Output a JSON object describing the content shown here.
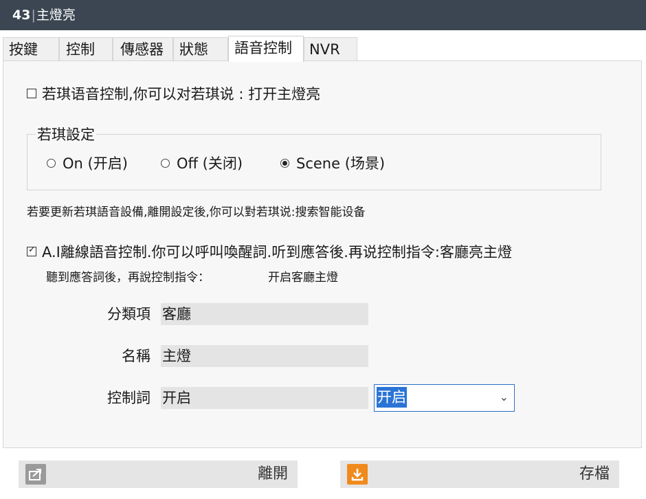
{
  "window": {
    "title_number": "43",
    "title_separator": "|",
    "title_text": "主燈亮"
  },
  "tabs": [
    {
      "label": "按鍵"
    },
    {
      "label": "控制"
    },
    {
      "label": "傳感器"
    },
    {
      "label": "狀態"
    },
    {
      "label": "語音控制"
    },
    {
      "label": "NVR"
    }
  ],
  "active_tab": "語音控制",
  "voice": {
    "ruoqi_checkbox": {
      "label": "若琪语音控制,你可以对若琪说 : 打开主燈亮",
      "checked": false
    },
    "settings_group": {
      "legend": "若琪設定",
      "options": [
        {
          "label": "On (开启)",
          "selected": false
        },
        {
          "label": "Off (关闭)",
          "selected": false
        },
        {
          "label": "Scene (场景)",
          "selected": true
        }
      ]
    },
    "update_hint": "若要更新若琪語音設備,離開設定後,你可以對若琪说:搜索智能设备",
    "ai_checkbox": {
      "label": "A.I離線語音控制.你可以呼叫喚醒詞.听到應答後.再说控制指令:客廳亮主燈",
      "checked": true
    },
    "ai_sub_label": "聽到應答詞後，再說控制指令：",
    "ai_sub_value": "开启客廳主燈",
    "fields": {
      "category": {
        "label": "分類項",
        "value": "客廳"
      },
      "name": {
        "label": "名稱",
        "value": "主燈"
      },
      "control_word": {
        "label": "控制詞",
        "value": "开启"
      }
    },
    "control_select": {
      "selected": "开启"
    }
  },
  "footer": {
    "leave_label": "離開",
    "save_label": "存檔",
    "leave_icon": "share-exit-icon",
    "save_icon": "download-save-icon"
  },
  "colors": {
    "titlebar": "#3b4652",
    "accent_orange": "#f08a1c",
    "selection_blue": "#2a74d6"
  }
}
